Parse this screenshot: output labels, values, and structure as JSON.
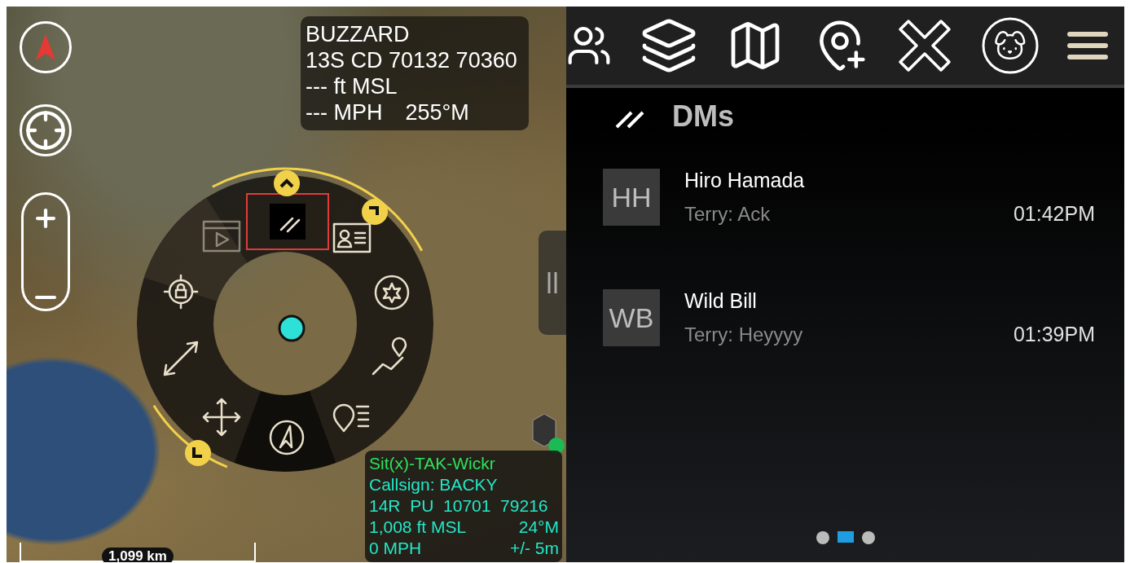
{
  "target_info": {
    "name": "BUZZARD",
    "grid": "13S CD 70132 70360",
    "altitude": "--- ft MSL",
    "speed": "--- MPH",
    "bearing": "255°M"
  },
  "radial_menu": {
    "items": [
      {
        "kind": "video",
        "selected": false
      },
      {
        "kind": "chat",
        "selected": true
      },
      {
        "kind": "contact",
        "selected": false
      },
      {
        "kind": "burst",
        "selected": false
      },
      {
        "kind": "route",
        "selected": false
      },
      {
        "kind": "pin-list",
        "selected": false
      },
      {
        "kind": "compass",
        "selected": false
      },
      {
        "kind": "move",
        "selected": false
      },
      {
        "kind": "range",
        "selected": false
      },
      {
        "kind": "lock",
        "selected": false
      }
    ]
  },
  "self_info": {
    "title": "Sit(x)-TAK-Wickr",
    "callsign": "Callsign: BACKY",
    "grid": "14R  PU  10701  79216",
    "altitude": "1,008 ft MSL",
    "heading": "24°M",
    "speed": "0 MPH",
    "accuracy": "+/- 5m"
  },
  "scale_bar": {
    "label": "1,099 km"
  },
  "panel": {
    "title": "DMs",
    "conversations": [
      {
        "initials": "HH",
        "name": "Hiro Hamada",
        "preview": "Terry: Ack",
        "time": "01:42PM"
      },
      {
        "initials": "WB",
        "name": "Wild Bill",
        "preview": "Terry: Heyyyy",
        "time": "01:39PM"
      }
    ]
  },
  "pager": {
    "pages": [
      {
        "selected": false
      },
      {
        "selected": true
      },
      {
        "selected": false
      }
    ]
  }
}
